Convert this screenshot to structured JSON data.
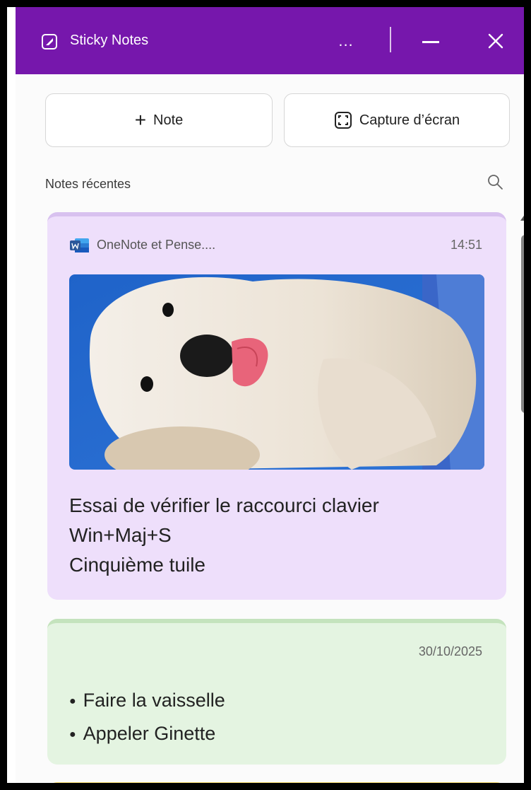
{
  "window": {
    "title": "Sticky Notes",
    "more_label": "..."
  },
  "toolbar": {
    "note_plus": "+",
    "note_label": "Note",
    "capture_label": "Capture d’écran"
  },
  "section": {
    "recent_label": "Notes récentes"
  },
  "notes": [
    {
      "source": "OneNote et Pense....",
      "time": "14:51",
      "image": "puppy-photo",
      "lines": [
        "Essai de vérifier le raccourci clavier",
        "Win+Maj+S",
        "Cinquième tuile"
      ],
      "color": "#eedffb"
    },
    {
      "date": "30/10/2025",
      "bullets": [
        "Faire la vaisselle",
        "Appeler Ginette"
      ],
      "color": "#e4f4e1"
    },
    {
      "color": "#fff6cf"
    }
  ],
  "colors": {
    "titlebar": "#7617ac",
    "word_blue": "#2b579a"
  },
  "icons": {
    "app": "sticky-note-icon",
    "more": "more-icon",
    "minimize": "minimize-icon",
    "close": "close-icon",
    "capture": "screen-capture-icon",
    "search": "search-icon",
    "source": "word-icon"
  }
}
